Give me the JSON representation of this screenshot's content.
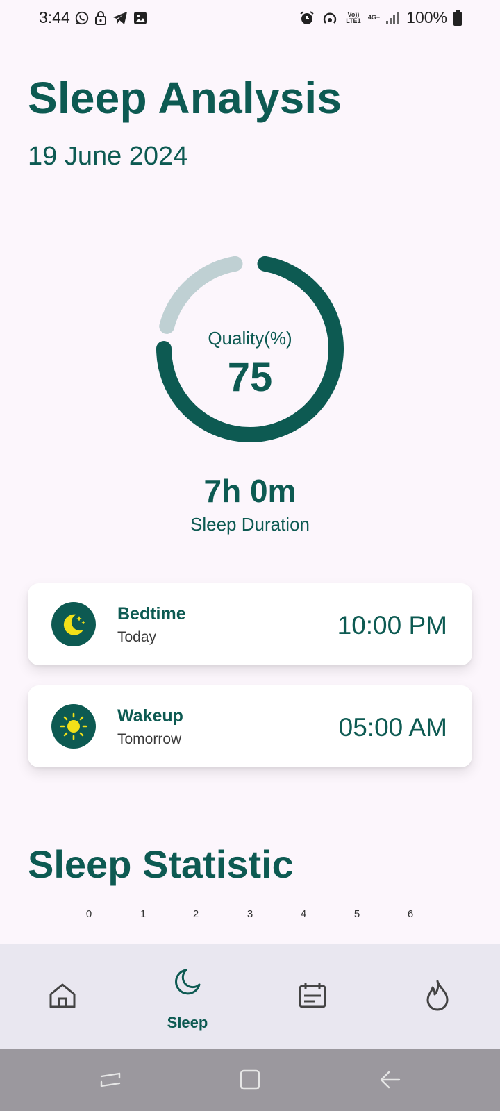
{
  "status_bar": {
    "time": "3:44",
    "left_icons": [
      "whatsapp-icon",
      "lock-icon",
      "telegram-icon",
      "gallery-icon"
    ],
    "right_icons": [
      "alarm-icon",
      "hotspot-icon",
      "volte-icon",
      "network-4g-icon",
      "signal-icon"
    ],
    "volte_text": "Vo)) LTE1",
    "network_text": "4G+",
    "battery": "100%"
  },
  "header": {
    "title": "Sleep Analysis",
    "date": "19 June 2024"
  },
  "quality": {
    "label": "Quality(%)",
    "value": "75",
    "fraction": 0.75
  },
  "duration": {
    "value": "7h 0m",
    "label": "Sleep Duration"
  },
  "cards": [
    {
      "title": "Bedtime",
      "subtitle": "Today",
      "time": "10:00 PM",
      "icon": "moon-stars-icon"
    },
    {
      "title": "Wakeup",
      "subtitle": "Tomorrow",
      "time": "05:00 AM",
      "icon": "sun-icon"
    }
  ],
  "statistic": {
    "title": "Sleep Statistic",
    "x_ticks": [
      "0",
      "1",
      "2",
      "3",
      "4",
      "5",
      "6"
    ]
  },
  "bottom_nav": {
    "items": [
      {
        "icon": "home-icon",
        "label": "",
        "active": false
      },
      {
        "icon": "moon-icon",
        "label": "Sleep",
        "active": true
      },
      {
        "icon": "calendar-icon",
        "label": "",
        "active": false
      },
      {
        "icon": "flame-icon",
        "label": "",
        "active": false
      }
    ]
  },
  "colors": {
    "accent": "#0d5a52",
    "ring_track": "#bfd0d3",
    "background": "#fcf6fc",
    "nav_bg": "#e9e7f0",
    "sun_yellow": "#f2e018"
  }
}
